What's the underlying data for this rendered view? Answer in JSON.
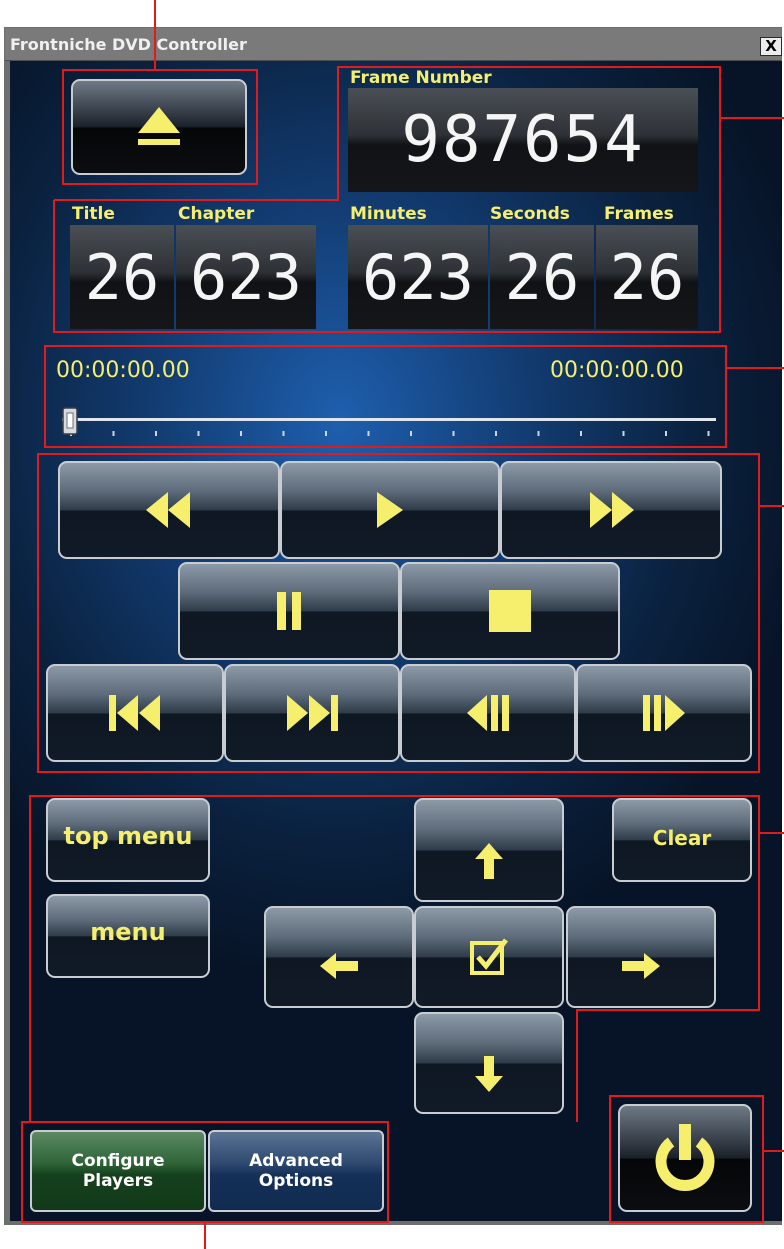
{
  "window": {
    "title": "Frontniche DVD Controller",
    "close_label": "X"
  },
  "frame_number": {
    "label": "Frame Number",
    "value": "987654"
  },
  "counters": [
    {
      "label": "Title",
      "value": "26"
    },
    {
      "label": "Chapter",
      "value": "623"
    },
    {
      "label": "Minutes",
      "value": "623"
    },
    {
      "label": "Seconds",
      "value": "26"
    },
    {
      "label": "Frames",
      "value": "26"
    }
  ],
  "timeline": {
    "current_time": "00:00:00.00",
    "total_time": "00:00:00.00",
    "position": 0
  },
  "navigation": {
    "top_menu": "top menu",
    "menu": "menu",
    "clear": "Clear"
  },
  "footer": {
    "configure_players": [
      "Configure",
      "Players"
    ],
    "advanced_options": [
      "Advanced",
      "Options"
    ]
  },
  "icons": [
    "eject-icon",
    "rewind-icon",
    "play-icon",
    "fast-forward-icon",
    "pause-icon",
    "stop-icon",
    "skip-previous-icon",
    "skip-next-icon",
    "step-back-icon",
    "step-forward-icon",
    "arrow-up-icon",
    "arrow-left-icon",
    "checkbox-icon",
    "arrow-right-icon",
    "arrow-down-icon",
    "power-icon"
  ],
  "colors": {
    "accent_yellow": "#f6ef6e",
    "annotation_red": "#e11b1b",
    "background_blue": "#1e5fae"
  }
}
